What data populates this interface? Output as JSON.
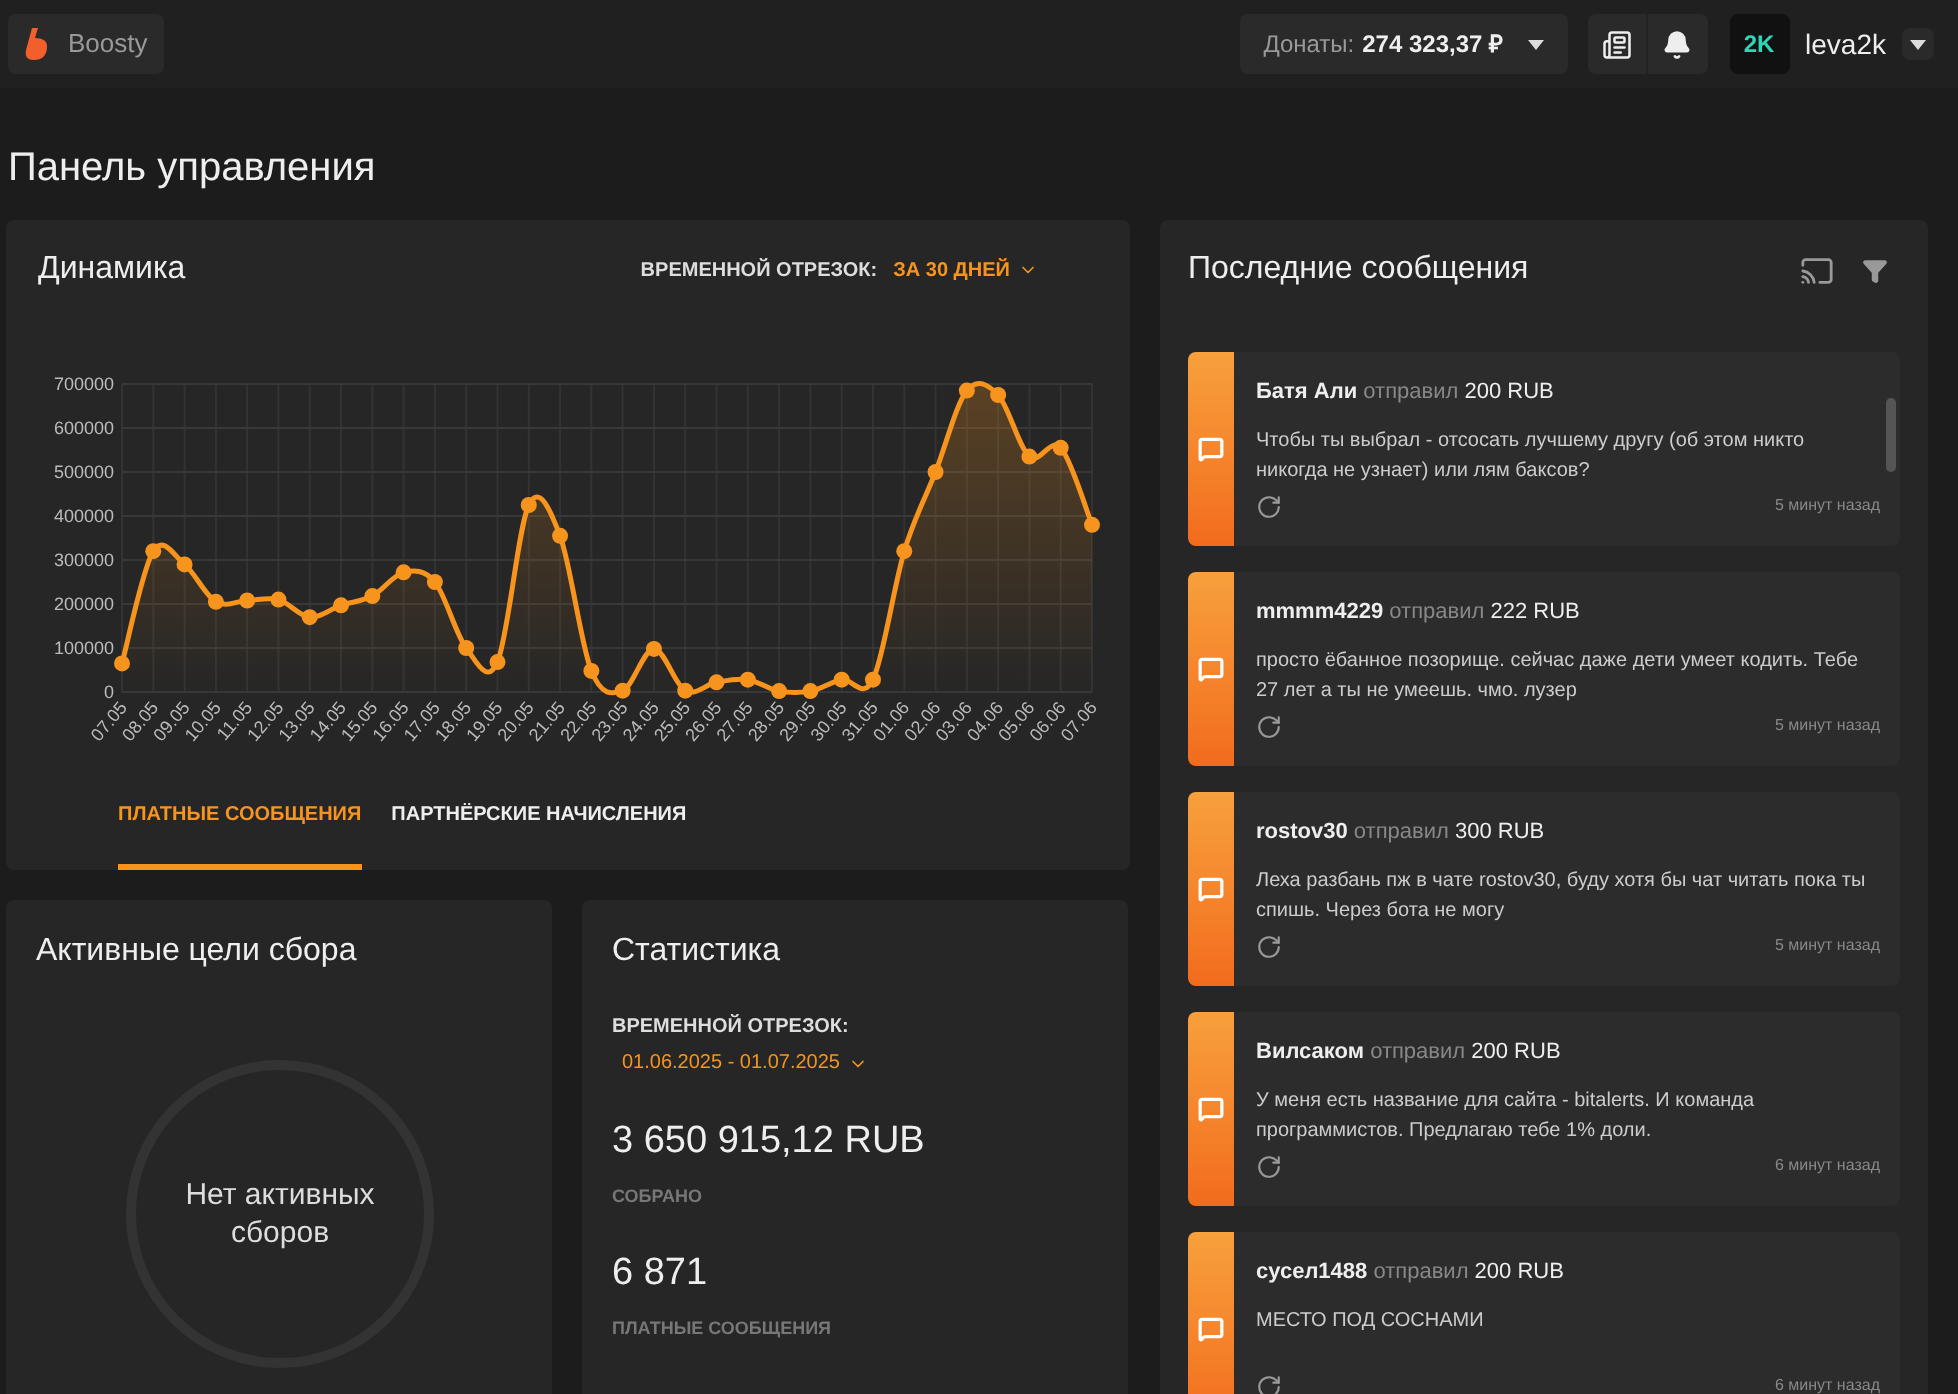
{
  "topbar": {
    "brand": "Boosty",
    "donations_label": "Донаты:",
    "donations_value": "274 323,37 ₽",
    "avatar_text": "2K",
    "username": "leva2k"
  },
  "page_title": "Панель управления",
  "dynamics": {
    "title": "Динамика",
    "period_label": "ВРЕМЕННОЙ ОТРЕЗОК:",
    "period_value": "ЗА 30 ДНЕЙ",
    "chart_data": {
      "type": "area",
      "categories": [
        "07.05",
        "08.05",
        "09.05",
        "10.05",
        "11.05",
        "12.05",
        "13.05",
        "14.05",
        "15.05",
        "16.05",
        "17.05",
        "18.05",
        "19.05",
        "20.05",
        "21.05",
        "22.05",
        "23.05",
        "24.05",
        "25.05",
        "26.05",
        "27.05",
        "28.05",
        "29.05",
        "30.05",
        "31.05",
        "01.06",
        "02.06",
        "03.06",
        "04.06",
        "05.06",
        "06.06",
        "07.06"
      ],
      "grid": true,
      "series": [
        {
          "color": "#f7941d",
          "values": [
            65000,
            320000,
            290000,
            205000,
            208000,
            210000,
            170000,
            197000,
            218000,
            272000,
            250000,
            100000,
            68000,
            425000,
            355000,
            48000,
            3000,
            98000,
            3000,
            22000,
            28000,
            2000,
            2000,
            28000,
            28000,
            320000,
            500000,
            685000,
            675000,
            535000,
            555000,
            380000
          ]
        }
      ],
      "ylim": [
        0,
        700000
      ],
      "yticks": [
        0,
        100000,
        200000,
        300000,
        400000,
        500000,
        600000,
        700000
      ]
    },
    "tabs": [
      {
        "label": "ПЛАТНЫЕ СООБЩЕНИЯ",
        "selected": true
      },
      {
        "label": "ПАРТНЁРСКИЕ НАЧИСЛЕНИЯ",
        "selected": false
      }
    ]
  },
  "goals": {
    "title": "Активные цели сбора",
    "empty_text": "Нет активных сборов"
  },
  "stats": {
    "title": "Статистика",
    "period_label": "ВРЕМЕННОЙ ОТРЕЗОК:",
    "period_value": "01.06.2025 - 01.07.2025",
    "items": [
      {
        "value": "3 650 915,12 RUB",
        "label": "СОБРАНО"
      },
      {
        "value": "6 871",
        "label": "ПЛАТНЫЕ СООБЩЕНИЯ"
      }
    ]
  },
  "messages": {
    "title": "Последние сообщения",
    "items": [
      {
        "author": "Батя Али",
        "verb": "отправил",
        "amount": "200 RUB",
        "text": "Чтобы ты выбрал - отсосать лучшему другу (об этом никто никогда не узнает) или лям баксов?",
        "time": "5 минут назад"
      },
      {
        "author": "mmmm4229",
        "verb": "отправил",
        "amount": "222 RUB",
        "text": "просто ёбанное позорище. сейчас даже дети умеет кодить. Тебе 27 лет а ты не умеешь. чмо. лузер",
        "time": "5 минут назад"
      },
      {
        "author": "rostov30",
        "verb": "отправил",
        "amount": "300 RUB",
        "text": "Леха разбань пж в чате rostov30, буду хотя бы чат читать пока ты спишь. Через бота не могу",
        "time": "5 минут назад"
      },
      {
        "author": "Вилсаком",
        "verb": "отправил",
        "amount": "200 RUB",
        "text": "У меня есть название для сайта - bitalerts. И команда программистов. Предлагаю тебе 1% доли.",
        "time": "6 минут назад"
      },
      {
        "author": "сусел1488",
        "verb": "отправил",
        "amount": "200 RUB",
        "text": "МЕСТО ПОД СОСНАМИ",
        "time": "6 минут назад"
      }
    ]
  }
}
